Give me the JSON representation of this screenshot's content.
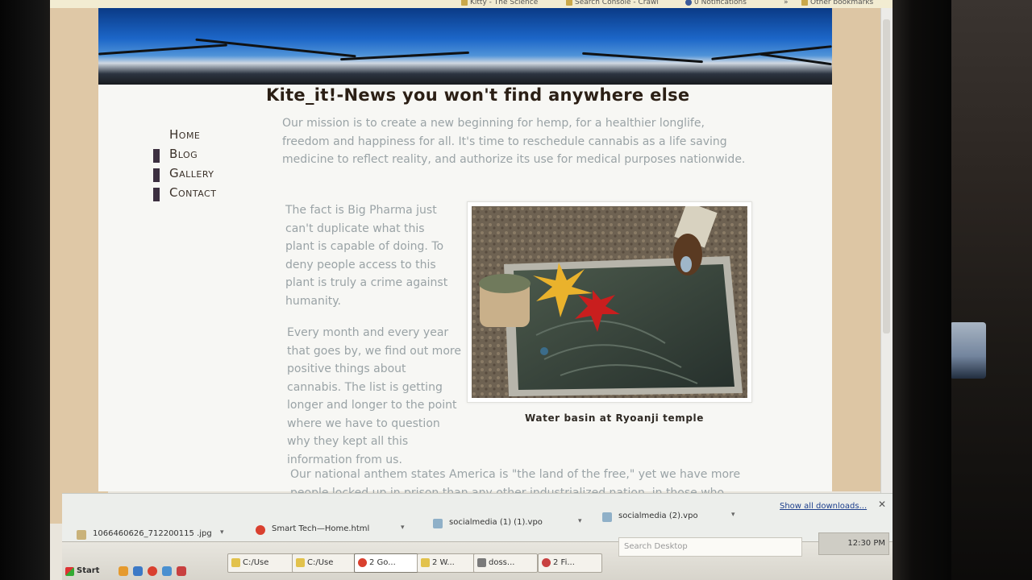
{
  "bookmarks": [
    {
      "label": "Kitty - The Science",
      "icon": "page-icon"
    },
    {
      "label": "Search Console - Crawl",
      "icon": "search-console-icon"
    },
    {
      "label": "0 Notifications",
      "icon": "facebook-icon"
    },
    {
      "label": "»",
      "icon": ""
    },
    {
      "label": "Other bookmarks",
      "icon": "folder-icon"
    }
  ],
  "site": {
    "title": "Kite_it!-News you won't find anywhere else",
    "nav": [
      {
        "label": "Home",
        "active": true
      },
      {
        "label": "Blog",
        "active": false
      },
      {
        "label": "Gallery",
        "active": false
      },
      {
        "label": "Contact",
        "active": false
      }
    ],
    "mission": "Our mission is to create a new beginning for hemp, for a healthier longlife, freedom and happiness for all. It's time to reschedule cannabis as a life saving medicine to reflect reality, and authorize its use for medical purposes nationwide.",
    "para_pharma": "The fact is Big Pharma just can't duplicate what this plant is capable of doing. To deny people access to this plant is truly a crime against humanity.",
    "para_month": "Every month and every year that goes by, we find out more positive things about cannabis. The list is getting longer and longer to the point where we have to question why they kept all this information from us.",
    "para_anthem": "Our national anthem states America is \"the land of the free,\" yet we have more people locked up in prison than any other industrialized nation, in those who",
    "photo_caption": "Water basin at Ryoanji temple"
  },
  "downloads": {
    "items": [
      {
        "label": "1066460626_712200115 .jpg",
        "icon": "image-file-icon",
        "color": "#c9b27a"
      },
      {
        "label": "Smart Tech—Home.html",
        "icon": "chrome-icon",
        "color": "#d9402f"
      },
      {
        "label": "socialmedia (1) (1).vpo",
        "icon": "file-icon",
        "color": "#8fb0c8"
      },
      {
        "label": "socialmedia (2).vpo",
        "icon": "file-icon",
        "color": "#8fb0c8"
      }
    ],
    "show_all": "Show all downloads...",
    "close": "✕"
  },
  "taskbar": {
    "start": "Start",
    "buttons": [
      {
        "label": "C:/Use",
        "color": "#e2c24c"
      },
      {
        "label": "C:/Use",
        "color": "#e2c24c"
      },
      {
        "label": "2 Go...",
        "color": "#d9402f"
      },
      {
        "label": "2 W...",
        "color": "#e2c24c"
      },
      {
        "label": "doss...",
        "color": "#7a7a7a"
      },
      {
        "label": "2 Fi...",
        "color": "#c84040"
      }
    ],
    "search_placeholder": "Search Desktop",
    "clock": "12:30 PM"
  },
  "colors": {
    "title": "#2b1f15",
    "body_text_faded": "#9aa3a6",
    "nav_bullet": "#3c3040",
    "page_strip": "#dfc8a6"
  }
}
